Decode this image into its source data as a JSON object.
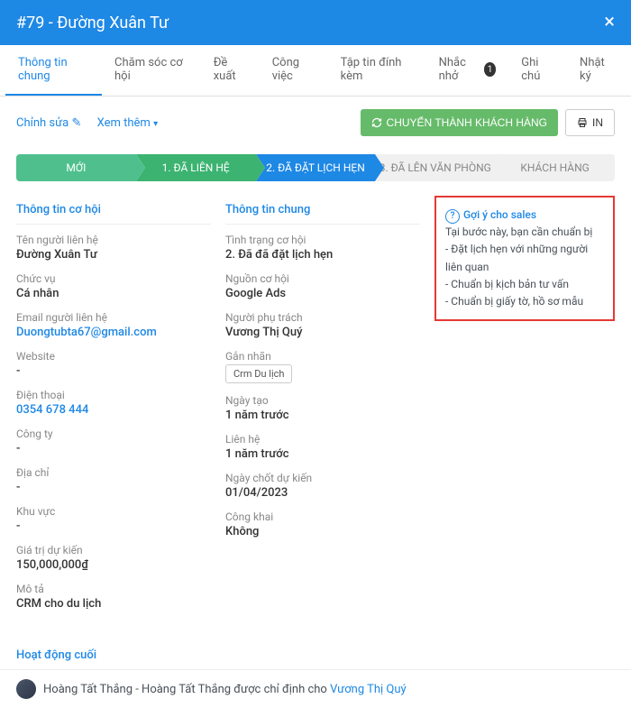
{
  "header": {
    "title": "#79 - Đường Xuân Tư",
    "close": "×"
  },
  "tabs": [
    {
      "label": "Thông tin chung",
      "active": true
    },
    {
      "label": "Chăm sóc cơ hội"
    },
    {
      "label": "Đề xuất"
    },
    {
      "label": "Công việc"
    },
    {
      "label": "Tập tin đính kèm"
    },
    {
      "label": "Nhắc nhở",
      "badge": "1"
    },
    {
      "label": "Ghi chú"
    },
    {
      "label": "Nhật ký"
    }
  ],
  "toolbar": {
    "edit": "Chỉnh sửa",
    "more": "Xem thêm",
    "convert": "CHUYỂN THÀNH KHÁCH HÀNG",
    "print": "IN"
  },
  "stages": [
    "MỚI",
    "1. ĐÃ LIÊN HỆ",
    "2.     ĐÃ ĐẶT LỊCH HẸN",
    "3. ĐÃ LÊN VĂN PHÒNG",
    "KHÁCH HÀNG"
  ],
  "left": {
    "title": "Thông tin cơ hội",
    "fields": [
      {
        "label": "Tên người liên hệ",
        "value": "Đường Xuân Tư"
      },
      {
        "label": "Chức vụ",
        "value": "Cá nhân"
      },
      {
        "label": "Email người liên hệ",
        "value": "Duongtubta67@gmail.com",
        "link": true
      },
      {
        "label": "Website",
        "value": "-"
      },
      {
        "label": "Điện thoại",
        "value": "0354 678 444",
        "link": true
      },
      {
        "label": "Công ty",
        "value": "-"
      },
      {
        "label": "Địa chỉ",
        "value": "-"
      },
      {
        "label": "Khu vực",
        "value": "-"
      },
      {
        "label": "Giá trị dự kiến",
        "value": "150,000,000₫"
      },
      {
        "label": "Mô tả",
        "value": "CRM cho du lịch"
      }
    ]
  },
  "middle": {
    "title": "Thông tin chung",
    "fields": [
      {
        "label": "Tình trạng cơ hội",
        "value": "2. Đã đã đặt lịch hẹn"
      },
      {
        "label": "Nguồn cơ hội",
        "value": "Google Ads"
      },
      {
        "label": "Người phụ trách",
        "value": "Vương Thị Quý"
      },
      {
        "label": "Gắn nhãn",
        "tag": "Crm Du lịch"
      },
      {
        "label": "Ngày tạo",
        "value": "1 năm trước"
      },
      {
        "label": "Liên hệ",
        "value": "1 năm trước"
      },
      {
        "label": "Ngày chốt dự kiến",
        "value": "01/04/2023"
      },
      {
        "label": "Công khai",
        "value": "Không"
      }
    ]
  },
  "hint": {
    "title": "Gợi ý cho sales",
    "lines": [
      "Tại bước này, bạn cần chuẩn bị",
      "- Đặt lịch hẹn với những người liên quan",
      "- Chuẩn bị kịch bản tư vấn",
      "- Chuẩn bị giấy tờ, hồ sơ mẫu"
    ]
  },
  "activity": {
    "title": "Hoạt động cuối",
    "prefix": "Hoàng Tất Thắng - Hoàng Tất Thắng được chỉ định cho ",
    "assignee": "Vương Thị Quý"
  }
}
